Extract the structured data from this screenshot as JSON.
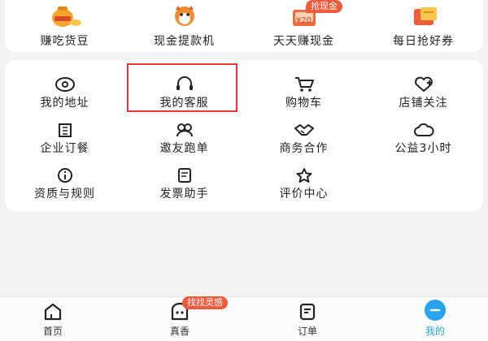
{
  "top_row": {
    "items": [
      {
        "label": "赚吃货豆"
      },
      {
        "label": "现金提款机"
      },
      {
        "label": "天天赚现金",
        "badge": "抢现金",
        "icon_text": "¥20"
      },
      {
        "label": "每日抢好券"
      }
    ]
  },
  "services": {
    "items": [
      {
        "label": "我的地址",
        "icon": "location-icon"
      },
      {
        "label": "我的客服",
        "icon": "headset-icon"
      },
      {
        "label": "购物车",
        "icon": "cart-icon"
      },
      {
        "label": "店铺关注",
        "icon": "heart-plus-icon"
      },
      {
        "label": "企业订餐",
        "icon": "building-icon"
      },
      {
        "label": "邀友跑单",
        "icon": "invite-icon"
      },
      {
        "label": "商务合作",
        "icon": "handshake-icon"
      },
      {
        "label": "公益3小时",
        "icon": "cloud-icon"
      },
      {
        "label": "资质与规则",
        "icon": "info-icon"
      },
      {
        "label": "发票助手",
        "icon": "invoice-icon"
      },
      {
        "label": "评价中心",
        "icon": "star-icon"
      }
    ]
  },
  "tabbar": {
    "tabs": [
      {
        "label": "首页",
        "icon": "home-icon"
      },
      {
        "label": "真香",
        "icon": "smile-bag-icon",
        "badge": "找找灵感"
      },
      {
        "label": "订单",
        "icon": "order-icon"
      },
      {
        "label": "我的",
        "icon": "profile-icon"
      }
    ]
  },
  "colors": {
    "accent": "#28a3f0",
    "badge": "#f15a3a",
    "highlight_border": "#e33333"
  }
}
